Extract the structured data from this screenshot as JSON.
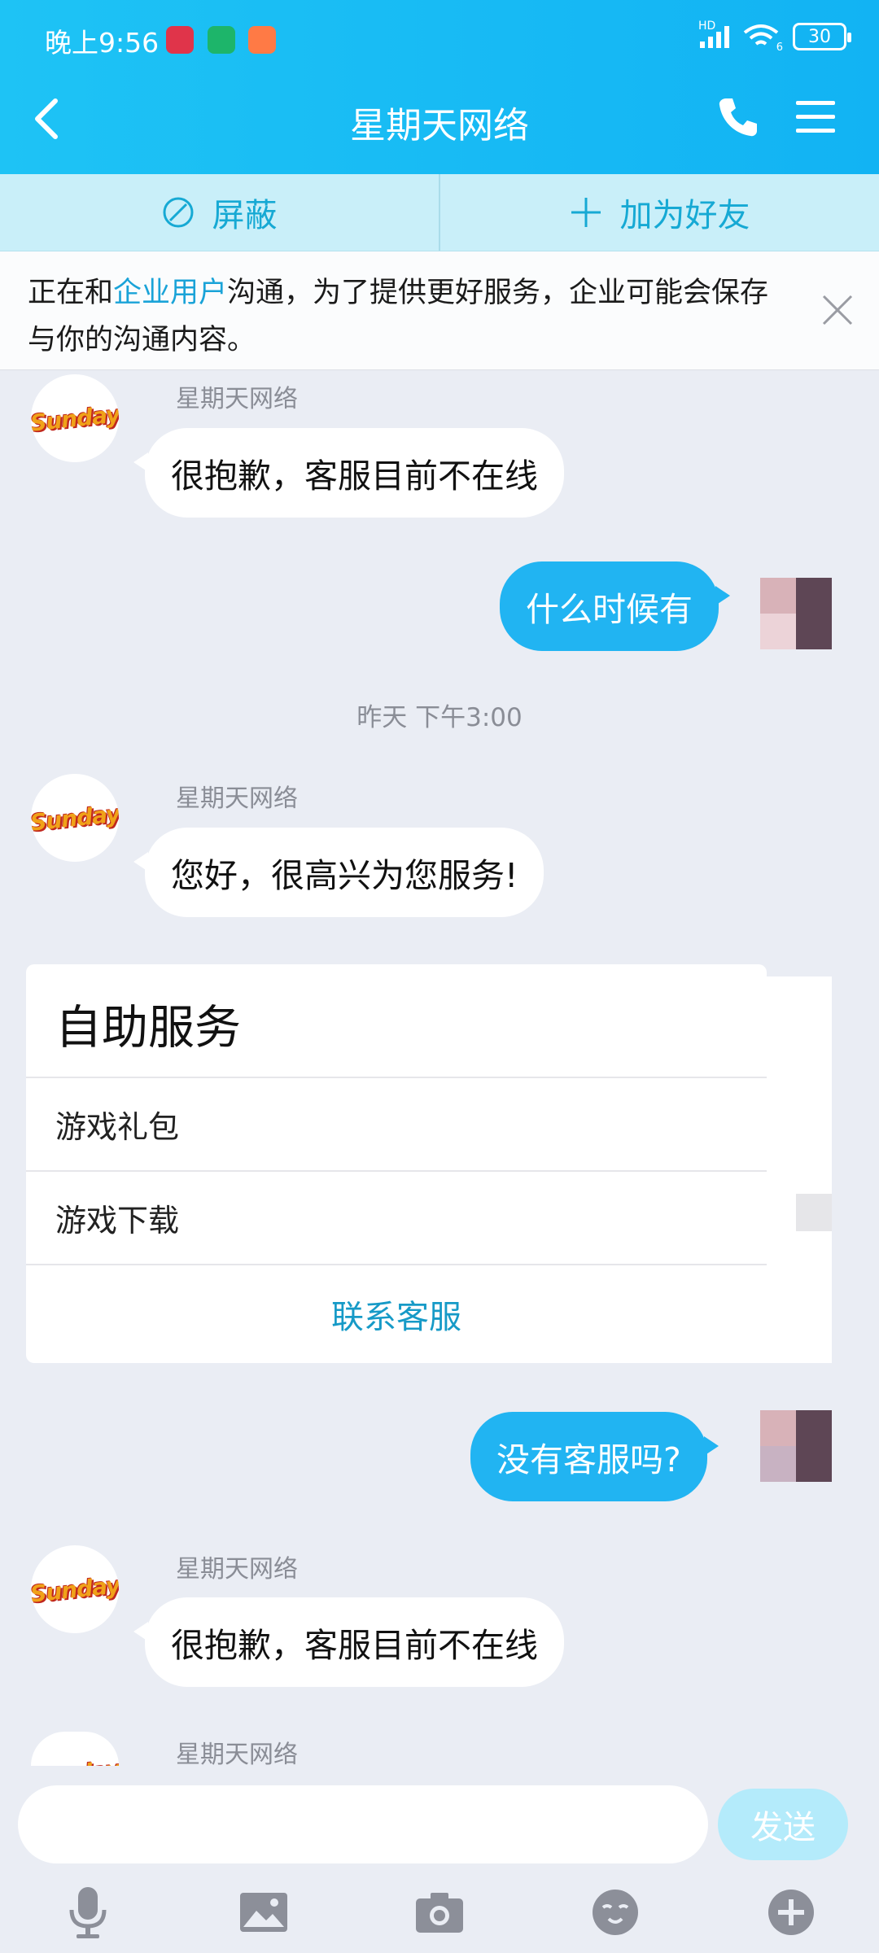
{
  "status_bar": {
    "time": "晚上9:56",
    "network": "HD",
    "wifi_badge": "6",
    "battery": "30"
  },
  "nav": {
    "title": "星期天网络"
  },
  "actions": {
    "block_label": "屏蔽",
    "add_friend_label": "加为好友"
  },
  "notice": {
    "prefix": "正在和",
    "link": "企业用户",
    "suffix": "沟通，为了提供更好服务，企业可能会保存与你的沟通内容。"
  },
  "messages": [
    {
      "sender": "星期天网络",
      "text": "很抱歉，客服目前不在线"
    },
    {
      "text": "什么时候有"
    },
    {
      "timestamp": "昨天 下午3:00"
    },
    {
      "sender": "星期天网络",
      "text": "您好，很高兴为您服务!"
    },
    {
      "text": "没有客服吗?"
    },
    {
      "sender": "星期天网络",
      "text": "很抱歉，客服目前不在线"
    },
    {
      "sender": "星期天网络"
    }
  ],
  "service_card": {
    "title": "自助服务",
    "items": [
      "游戏礼包",
      "游戏下载"
    ],
    "contact_label": "联系客服"
  },
  "avatar_logo_text": "Sunday",
  "input": {
    "placeholder": "",
    "send_label": "发送"
  },
  "toolbar": {
    "icons": [
      "microphone-icon",
      "image-icon",
      "camera-icon",
      "emoji-icon",
      "plus-icon"
    ]
  },
  "colors": {
    "header": "#1ec3f5",
    "accent": "#21b4f2",
    "link": "#1aa3d8",
    "background": "#eaedf4"
  }
}
